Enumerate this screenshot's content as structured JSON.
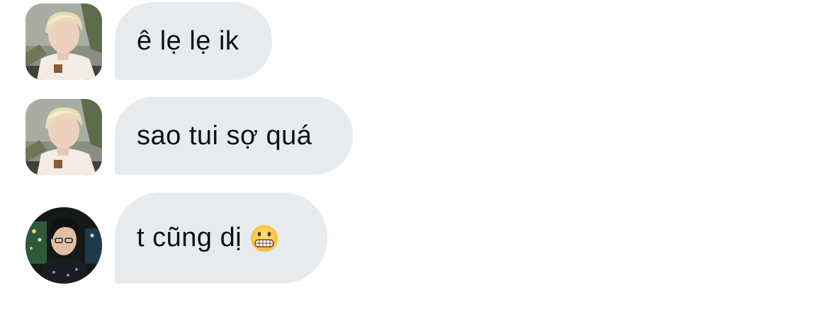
{
  "conversation": {
    "messages": [
      {
        "sender_avatar": "blond-hair-avatar",
        "text": "ê lẹ lẹ ik"
      },
      {
        "sender_avatar": "blond-hair-avatar",
        "text": "sao tui sợ quá"
      },
      {
        "sender_avatar": "dark-hair-avatar",
        "text": "t cũng dị",
        "emoji": "grimacing-face-emoji"
      }
    ]
  },
  "colors": {
    "bubble_background": "#e8ebee",
    "text": "#111111",
    "page_background": "#ffffff"
  }
}
